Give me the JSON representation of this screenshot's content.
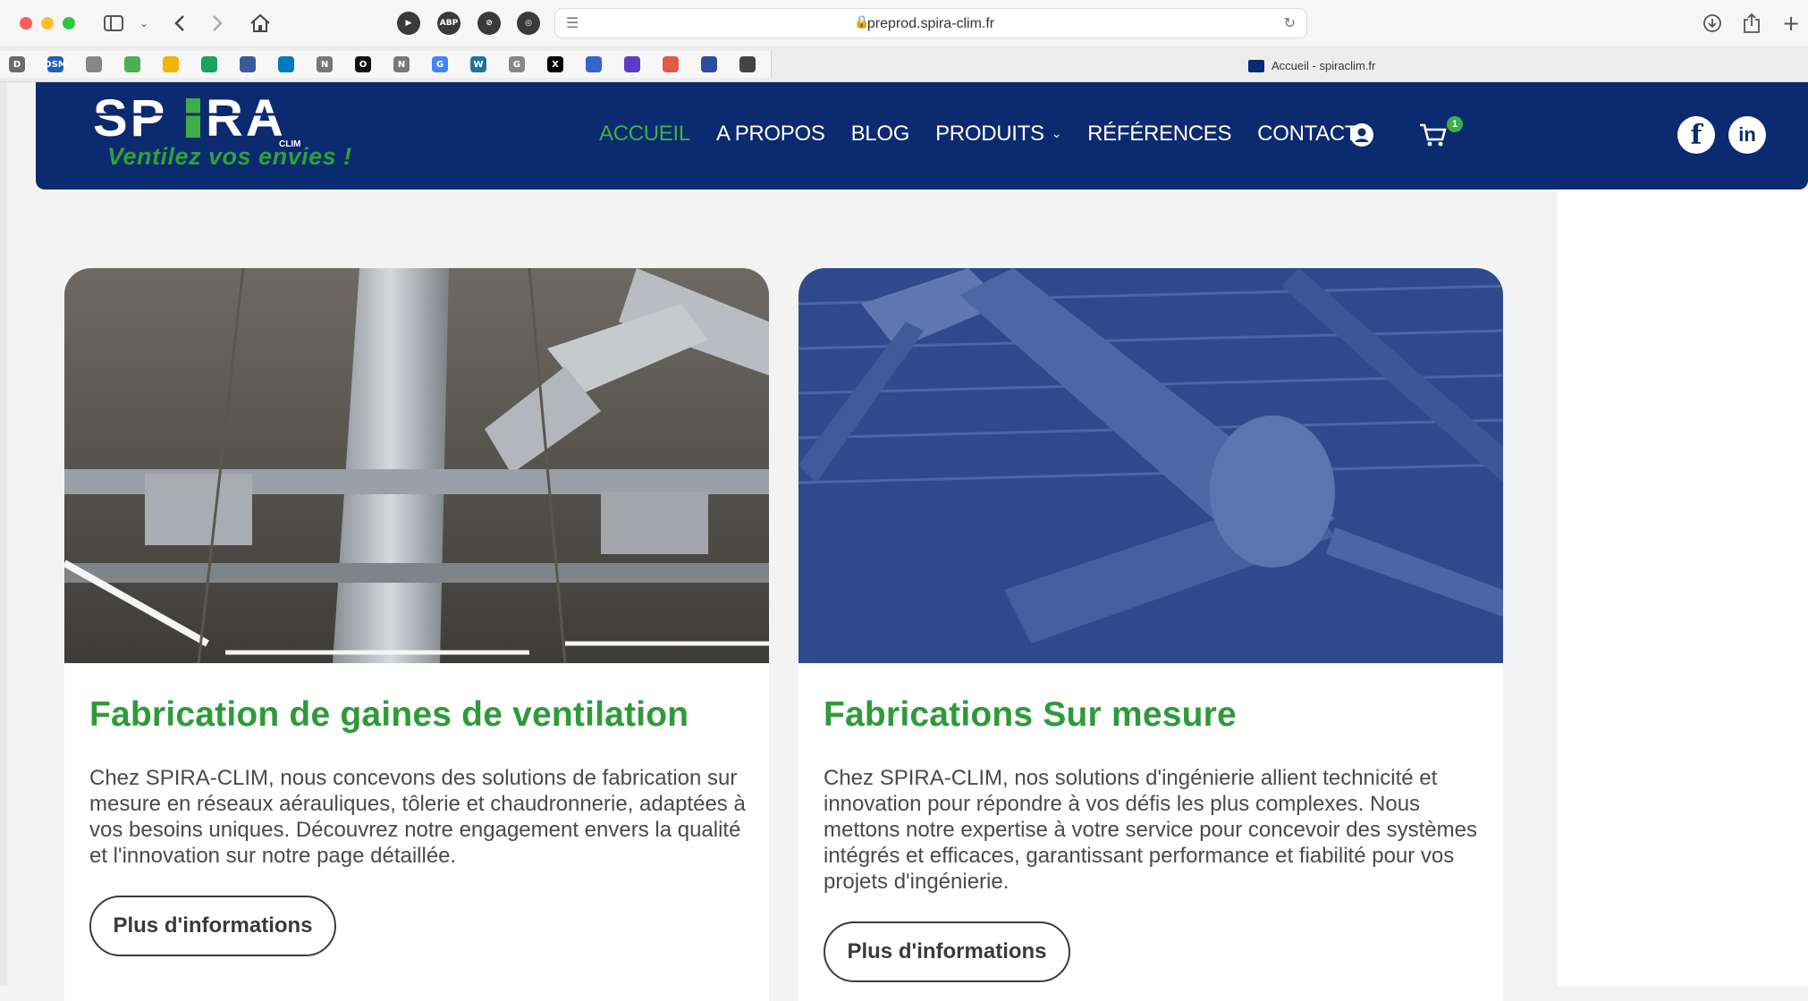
{
  "browser": {
    "url": "preprod.spira-clim.fr",
    "tab_title": "Accueil - spiraclim.fr",
    "extensions": [
      "ABP"
    ],
    "bookmarks": [
      {
        "label": "D",
        "color": "#6b6b6b"
      },
      {
        "label": "DSM",
        "color": "#1f5fbf"
      },
      {
        "label": "",
        "color": "#888888"
      },
      {
        "label": "",
        "color": "#4caf50"
      },
      {
        "label": "",
        "color": "#f4b400"
      },
      {
        "label": "",
        "color": "#1aa260"
      },
      {
        "label": "",
        "color": "#3b5998"
      },
      {
        "label": "",
        "color": "#0079bf"
      },
      {
        "label": "N",
        "color": "#777777"
      },
      {
        "label": "O",
        "color": "#111111"
      },
      {
        "label": "N",
        "color": "#777777"
      },
      {
        "label": "G",
        "color": "#4285f4"
      },
      {
        "label": "W",
        "color": "#21759b"
      },
      {
        "label": "G",
        "color": "#888888"
      },
      {
        "label": "X",
        "color": "#000000"
      },
      {
        "label": "",
        "color": "#3366cc"
      },
      {
        "label": "",
        "color": "#5b3cc4"
      },
      {
        "label": "",
        "color": "#e05a47"
      },
      {
        "label": "",
        "color": "#2b4c9b"
      },
      {
        "label": "",
        "color": "#444444"
      }
    ]
  },
  "site": {
    "logo": {
      "word": "SPIRA",
      "sub": "CLIM",
      "tagline": "Ventilez vos envies !"
    },
    "nav": [
      {
        "label": "ACCUEIL",
        "active": true
      },
      {
        "label": "A PROPOS"
      },
      {
        "label": "BLOG"
      },
      {
        "label": "PRODUITS",
        "has_dropdown": true
      },
      {
        "label": "RÉFÉRENCES"
      },
      {
        "label": "CONTACT"
      }
    ],
    "cart_count": "1",
    "social": {
      "facebook": "f",
      "linkedin": "in"
    }
  },
  "cards": [
    {
      "title": "Fabrication de gaines de ventilation",
      "text": "Chez SPIRA-CLIM, nous concevons des solutions de fabrication sur mesure en réseaux aérauliques, tôlerie et chaudronnerie, adaptées à vos besoins uniques. Découvrez notre engagement envers la qualité et l'innovation sur notre page détaillée.",
      "button": "Plus d'informations"
    },
    {
      "title": "Fabrications Sur mesure",
      "text": "Chez SPIRA-CLIM, nos solutions d'ingénierie allient technicité et innovation pour répondre à vos défis les plus complexes. Nous mettons notre expertise à votre service pour concevoir des systèmes intégrés et efficaces, garantissant performance et fiabilité pour vos projets d'ingénierie.",
      "button": "Plus d'informations"
    }
  ],
  "colors": {
    "brand_blue": "#0b2a6f",
    "brand_green": "#2e9a3a",
    "active_nav": "#3fae49"
  }
}
